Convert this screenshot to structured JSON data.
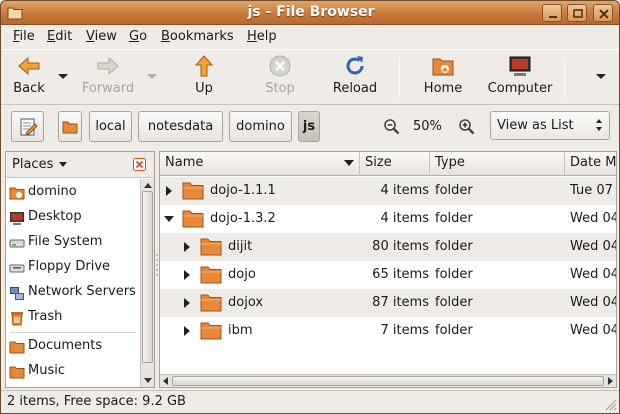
{
  "window": {
    "title": "js - File Browser"
  },
  "menubar": {
    "items": [
      {
        "label": "File",
        "mnemonic": "F",
        "rest": "ile"
      },
      {
        "label": "Edit",
        "mnemonic": "E",
        "rest": "dit"
      },
      {
        "label": "View",
        "mnemonic": "V",
        "rest": "iew"
      },
      {
        "label": "Go",
        "mnemonic": "G",
        "rest": "o"
      },
      {
        "label": "Bookmarks",
        "mnemonic": "B",
        "rest": "ookmarks"
      },
      {
        "label": "Help",
        "mnemonic": "H",
        "rest": "elp"
      }
    ]
  },
  "toolbar": {
    "back_label": "Back",
    "forward_label": "Forward",
    "up_label": "Up",
    "stop_label": "Stop",
    "reload_label": "Reload",
    "home_label": "Home",
    "computer_label": "Computer"
  },
  "location": {
    "crumbs": [
      "local",
      "notesdata",
      "domino",
      "js"
    ],
    "active_crumb": "js",
    "zoom_level": "50%",
    "view_mode": "View as List"
  },
  "sidebar": {
    "header": "Places",
    "items": [
      {
        "label": "domino",
        "icon": "home-folder-icon"
      },
      {
        "label": "Desktop",
        "icon": "desktop-icon"
      },
      {
        "label": "File System",
        "icon": "drive-icon"
      },
      {
        "label": "Floppy Drive",
        "icon": "floppy-icon"
      },
      {
        "label": "Network Servers",
        "icon": "network-icon"
      },
      {
        "label": "Trash",
        "icon": "trash-icon"
      },
      {
        "label": "Documents",
        "icon": "folder-icon"
      },
      {
        "label": "Music",
        "icon": "folder-icon"
      }
    ]
  },
  "file_list": {
    "columns": [
      "Name",
      "Size",
      "Type",
      "Date Modified"
    ],
    "column_visible_labels": [
      "Name",
      "Size",
      "Type",
      "Date M"
    ],
    "rows": [
      {
        "name": "dojo-1.1.1",
        "size": "4 items",
        "type": "folder",
        "date": "Tue 07",
        "depth": 0,
        "expanded": false
      },
      {
        "name": "dojo-1.3.2",
        "size": "4 items",
        "type": "folder",
        "date": "Wed 04",
        "depth": 0,
        "expanded": true
      },
      {
        "name": "dijit",
        "size": "80 items",
        "type": "folder",
        "date": "Wed 04",
        "depth": 1,
        "expanded": false
      },
      {
        "name": "dojo",
        "size": "65 items",
        "type": "folder",
        "date": "Wed 04",
        "depth": 1,
        "expanded": false
      },
      {
        "name": "dojox",
        "size": "87 items",
        "type": "folder",
        "date": "Wed 04",
        "depth": 1,
        "expanded": false
      },
      {
        "name": "ibm",
        "size": "7 items",
        "type": "folder",
        "date": "Wed 04",
        "depth": 1,
        "expanded": false
      }
    ]
  },
  "statusbar": {
    "text": "2 items, Free space: 9.2 GB"
  },
  "colors": {
    "titlebar": "#c97a3c",
    "folder": "#e8893a",
    "window_bg": "#efebe7"
  }
}
